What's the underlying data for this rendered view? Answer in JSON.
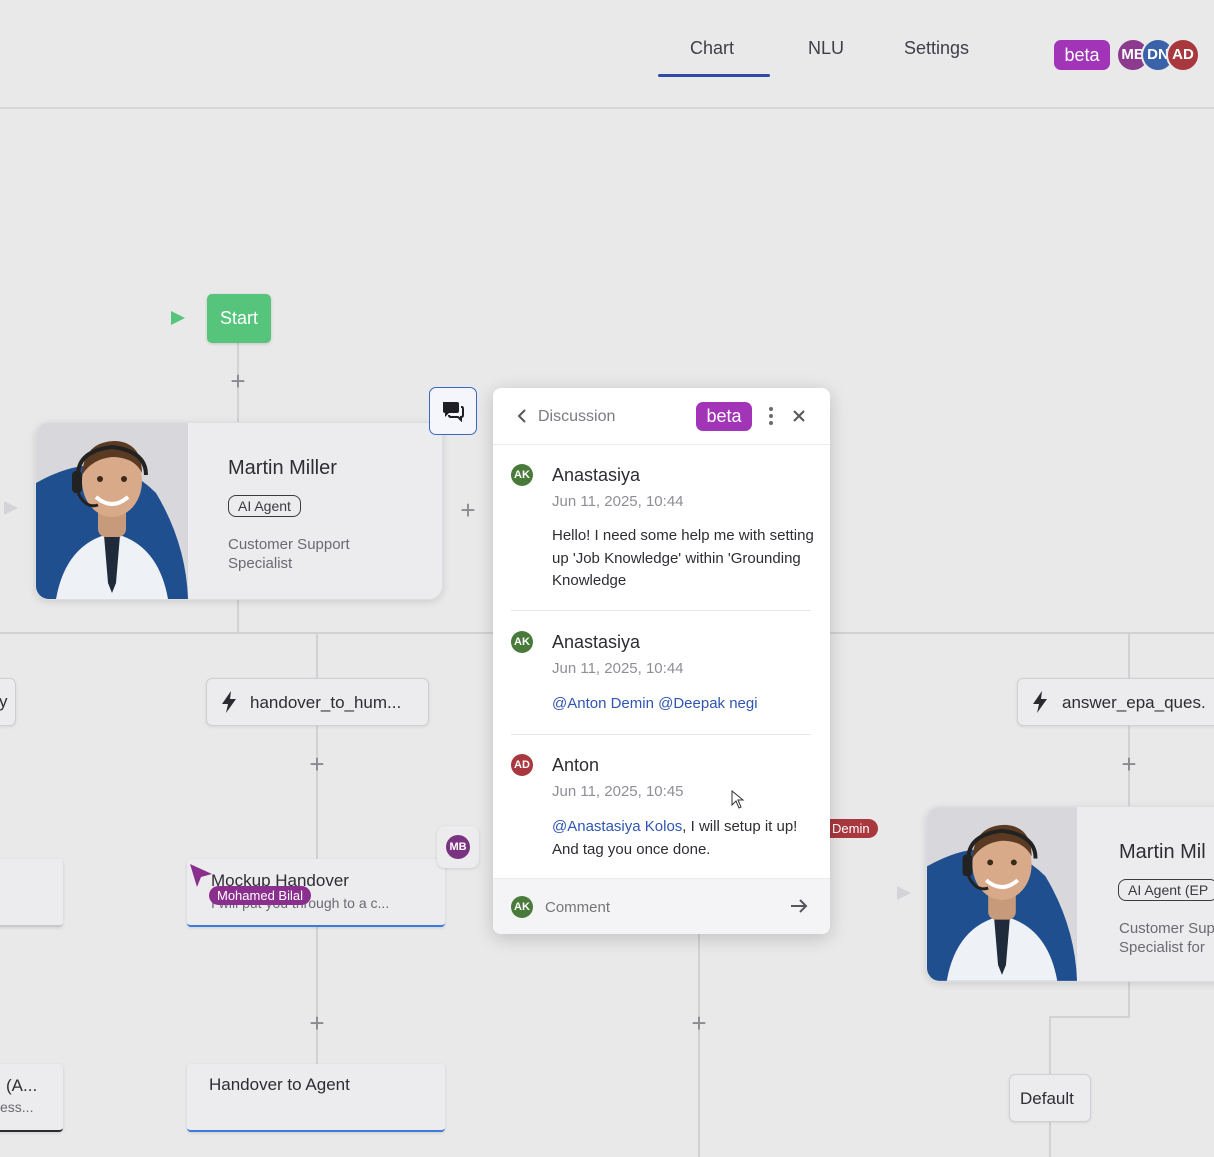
{
  "header": {
    "tabs": [
      {
        "label": "Chart",
        "active": true
      },
      {
        "label": "NLU",
        "active": false
      },
      {
        "label": "Settings",
        "active": false
      }
    ],
    "beta_label": "beta",
    "collaborators": [
      {
        "initials": "MB",
        "color": "#8c3a8e"
      },
      {
        "initials": "DN",
        "color": "#3a62a8"
      },
      {
        "initials": "AD",
        "color": "#a8383e"
      }
    ]
  },
  "flow": {
    "start_label": "Start",
    "agent_main": {
      "name": "Martin Miller",
      "tag": "AI Agent",
      "role": "Customer Support Specialist"
    },
    "agent_right": {
      "name": "Martin Mil",
      "tag": "AI Agent (EP",
      "role": "Customer Sup Specialist for"
    },
    "node_left_partial": "y",
    "node_handover_tool": "handover_to_hum...",
    "node_answer_tool": "answer_epa_ques.",
    "mockup_card": {
      "title": "Mockup Handover",
      "subtitle": "I will put you through to a c..."
    },
    "handover_card": {
      "title": "Handover to Agent"
    },
    "left_bottom_card": {
      "title": "(A...",
      "subtitle": "ess..."
    },
    "default_node": "Default",
    "cursor_user_label": "Mohamed Bilal",
    "mb_badge": "MB",
    "demin_chip": "Demin"
  },
  "discussion": {
    "title": "Discussion",
    "beta_label": "beta",
    "messages": [
      {
        "initials": "AK",
        "author": "Anastasiya",
        "time": "Jun 11, 2025, 10:44",
        "text": "Hello! I need some help me with setting up 'Job Knowledge' within 'Grounding Knowledge"
      },
      {
        "initials": "AK",
        "author": "Anastasiya",
        "time": "Jun 11, 2025, 10:44",
        "text": "@Anton Demin @Deepak negi"
      },
      {
        "initials": "AD",
        "author": "Anton",
        "time": "Jun 11, 2025, 10:45",
        "mention": "@Anastasiya Kolos",
        "text": ", I will setup it up! And tag you once done."
      }
    ],
    "comment_initials": "AK",
    "comment_placeholder": "Comment"
  },
  "colors": {
    "accent": "#2f4aa8",
    "beta": "#a234b8",
    "start": "#56c47b",
    "ak_avatar": "#4a7a3a",
    "ad_avatar": "#a8383e"
  }
}
